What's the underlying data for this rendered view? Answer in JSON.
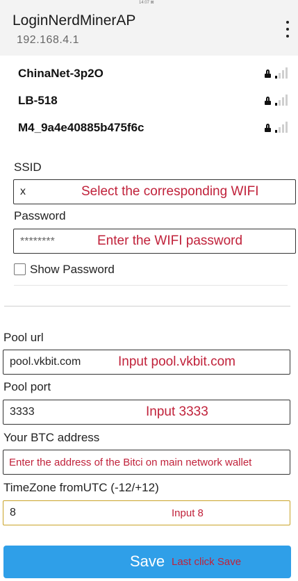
{
  "status_bar": {
    "text": "14:07 ⊠"
  },
  "header": {
    "title": "LoginNerdMinerAP",
    "subtitle": "192.168.4.1"
  },
  "wifi_networks": [
    {
      "name": "ChinaNet-3p2O",
      "locked": true,
      "signal_bars": 1
    },
    {
      "name": "LB-518",
      "locked": true,
      "signal_bars": 1
    },
    {
      "name": "M4_9a4e40885b475f6c",
      "locked": true,
      "signal_bars": 1
    }
  ],
  "form": {
    "ssid": {
      "label": "SSID",
      "value": "x",
      "hint": "Select the corresponding WIFI"
    },
    "password": {
      "label": "Password",
      "value": "********",
      "hint": "Enter the WIFI password"
    },
    "show_password": {
      "label": "Show Password",
      "checked": false
    },
    "pool_url": {
      "label": "Pool url",
      "value": "pool.vkbit.com",
      "hint": "Input pool.vkbit.com"
    },
    "pool_port": {
      "label": "Pool port",
      "value": "3333",
      "hint": "Input 3333"
    },
    "btc_address": {
      "label": "Your BTC address",
      "value": "",
      "hint": "Enter the address of the Bitci on main network wallet"
    },
    "timezone": {
      "label": "TimeZone fromUTC (-12/+12)",
      "value": "8",
      "hint": "Input 8"
    }
  },
  "save_button": {
    "label": "Save",
    "hint": "Last click Save"
  },
  "colors": {
    "header_bg": "#f3f3f3",
    "accent_button": "#2f9fe8",
    "hint_text": "#c0213a"
  },
  "icons": [
    "overflow-menu-icon",
    "lock-icon",
    "wifi-signal-icon",
    "checkbox-icon"
  ]
}
